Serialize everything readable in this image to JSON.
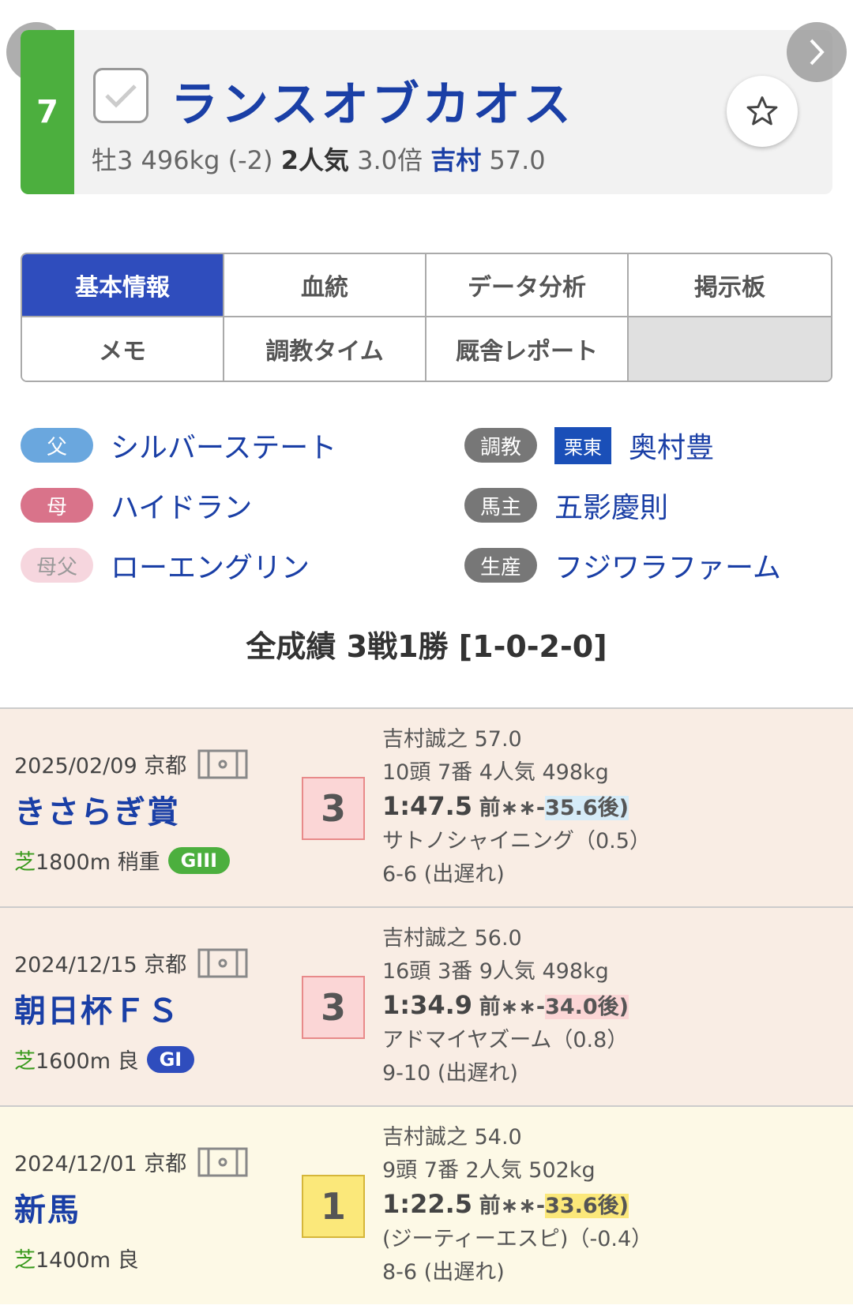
{
  "horse": {
    "number": "7",
    "name": "ランスオブカオス",
    "sex_age": "牡3",
    "weight": "496kg (-2)",
    "popularity": "2人気",
    "odds": "3.0倍",
    "jockey": "吉村",
    "burden": "57.0"
  },
  "tabs": [
    "基本情報",
    "血統",
    "データ分析",
    "掲示板",
    "メモ",
    "調教タイム",
    "厩舎レポート",
    ""
  ],
  "pedigree": {
    "father_label": "父",
    "father": "シルバーステート",
    "mother_label": "母",
    "mother": "ハイドラン",
    "mfather_label": "母父",
    "mfather": "ローエングリン",
    "trainer_label": "調教",
    "trainer_region": "栗東",
    "trainer": "奥村豊",
    "owner_label": "馬主",
    "owner": "五影慶則",
    "breeder_label": "生産",
    "breeder": "フジワラファーム"
  },
  "record": "全成績 3戦1勝 [1-0-2-0]",
  "races": [
    {
      "date": "2025/02/09 京都",
      "name": "きさらぎ賞",
      "surface": "芝",
      "cond": "1800m 稍重",
      "grade": "GIII",
      "rank": "3",
      "jockey_line": "吉村誠之 57.0",
      "field_line": "10頭 7番 4人気 498kg",
      "time": "1:47.5",
      "pos": "前∗∗-",
      "last": "35.6後)",
      "rival": "サトノシャイニング（0.5）",
      "passing": "6-6 (出遅れ)"
    },
    {
      "date": "2024/12/15 京都",
      "name": "朝日杯ＦＳ",
      "surface": "芝",
      "cond": "1600m 良",
      "grade": "GI",
      "rank": "3",
      "jockey_line": "吉村誠之 56.0",
      "field_line": "16頭 3番 9人気 498kg",
      "time": "1:34.9",
      "pos": "前∗∗-",
      "last": "34.0後)",
      "rival": "アドマイヤズーム（0.8）",
      "passing": "9-10 (出遅れ)"
    },
    {
      "date": "2024/12/01 京都",
      "name": "新馬",
      "surface": "芝",
      "cond": "1400m 良",
      "grade": "",
      "rank": "1",
      "jockey_line": "吉村誠之 54.0",
      "field_line": "9頭 7番 2人気 502kg",
      "time": "1:22.5",
      "pos": "前∗∗-",
      "last": "33.6後)",
      "rival": "(ジーティーエスピ)（-0.4）",
      "passing": "8-6 (出遅れ)"
    }
  ]
}
